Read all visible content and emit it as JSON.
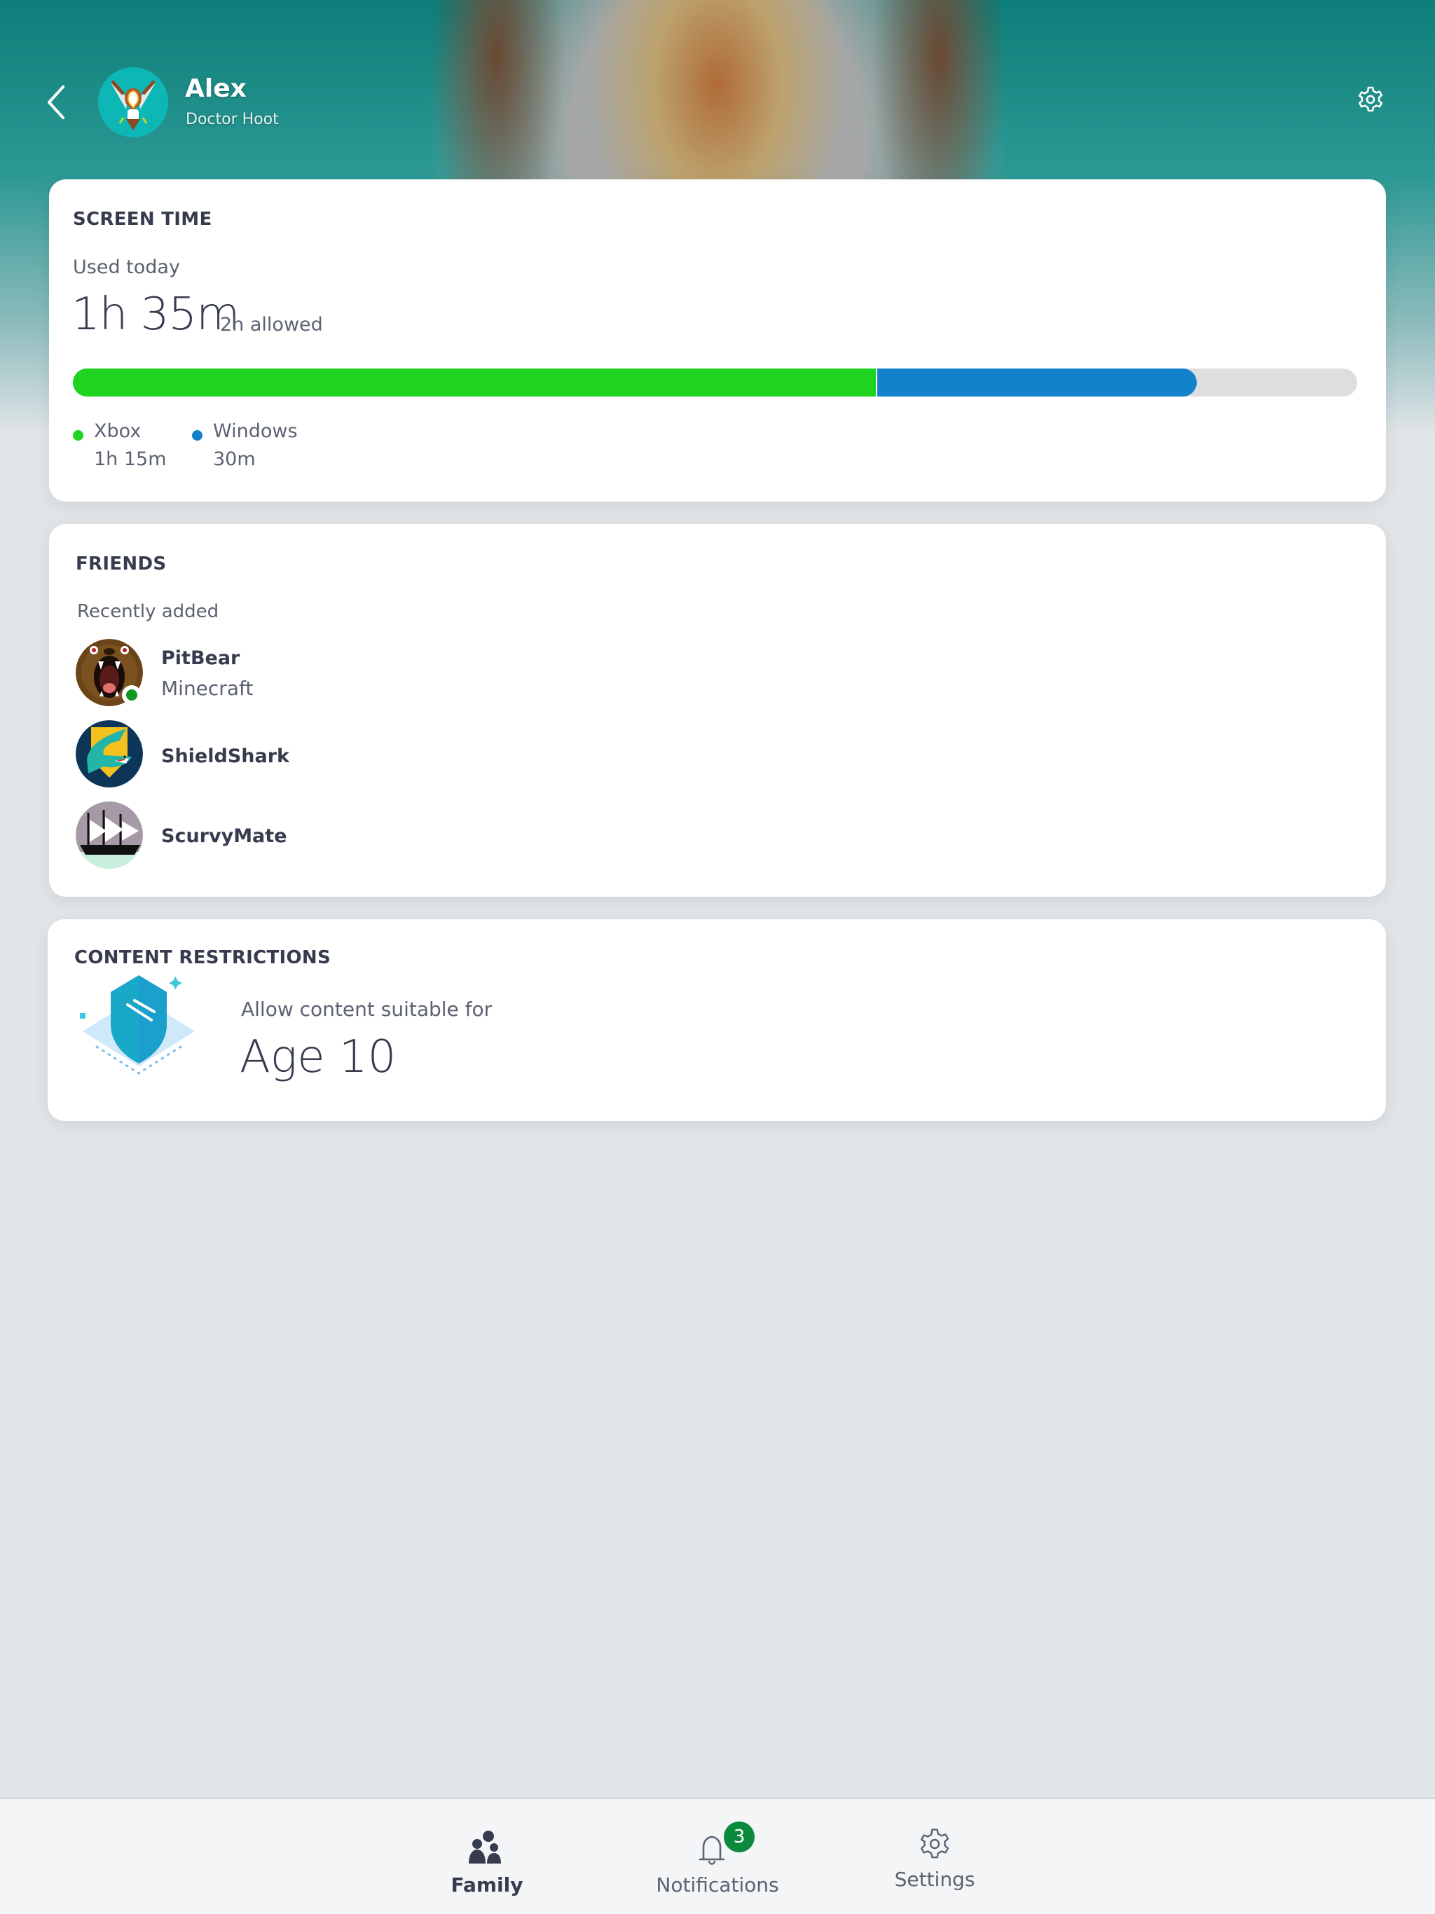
{
  "header": {
    "back_icon": "chevron-left-icon",
    "user_name": "Alex",
    "gamertag": "Doctor Hoot",
    "avatar": "owl-avatar",
    "settings_icon": "gear-icon"
  },
  "screen_time": {
    "title": "SCREEN TIME",
    "used_label": "Used today",
    "used_value": "1h 35m",
    "allowed": "2h allowed",
    "allowed_minutes": 120,
    "segments": [
      {
        "name": "Xbox",
        "value": "1h 15m",
        "minutes": 75,
        "color": "#1fd321"
      },
      {
        "name": "Windows",
        "value": "30m",
        "minutes": 30,
        "color": "#1282cb"
      }
    ],
    "track_color": "#dedede"
  },
  "friends": {
    "title": "FRIENDS",
    "subtitle": "Recently added",
    "items": [
      {
        "name": "PitBear",
        "activity": "Minecraft",
        "online": true,
        "avatar": "bear-avatar"
      },
      {
        "name": "ShieldShark",
        "activity": "",
        "online": false,
        "avatar": "shark-avatar"
      },
      {
        "name": "ScurvyMate",
        "activity": "",
        "online": false,
        "avatar": "ship-avatar"
      }
    ]
  },
  "content_restrictions": {
    "title": "CONTENT RESTRICTIONS",
    "allow_label": "Allow content suitable for",
    "age_value": "Age 10",
    "icon": "shield-icon"
  },
  "bottom_nav": {
    "items": [
      {
        "label": "Family",
        "icon": "family-icon",
        "active": true
      },
      {
        "label": "Notifications",
        "icon": "bell-icon",
        "badge": "3",
        "active": false
      },
      {
        "label": "Settings",
        "icon": "gear-icon",
        "active": false
      }
    ],
    "badge_color": "#0b8a3e"
  }
}
